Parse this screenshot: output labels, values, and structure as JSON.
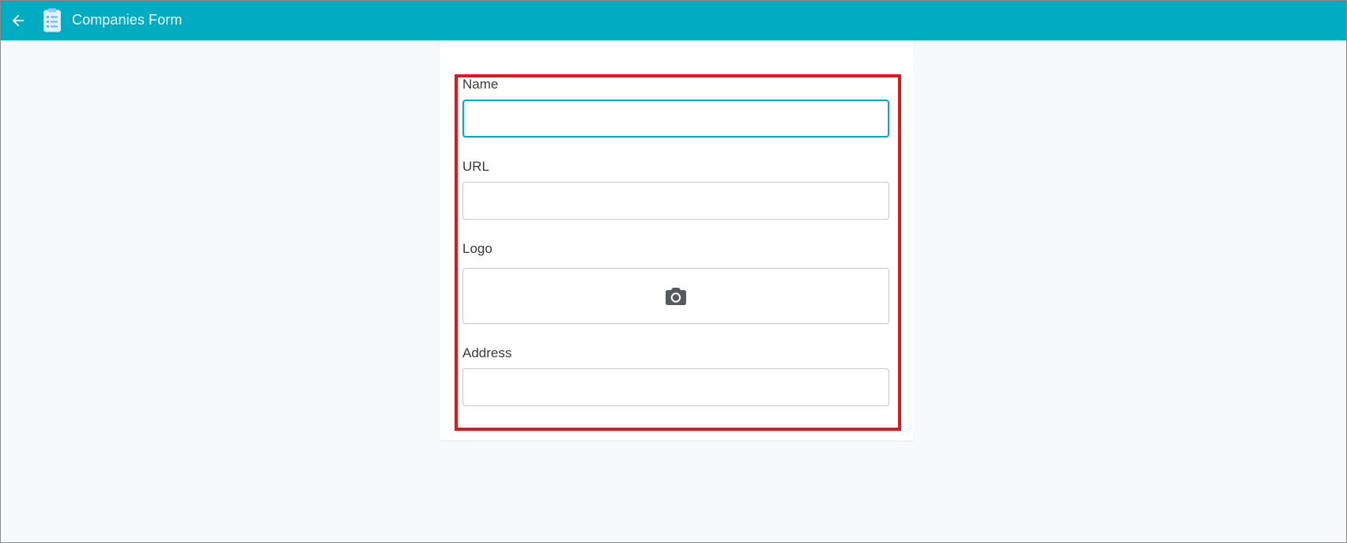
{
  "app_bar": {
    "title": "Companies Form",
    "back_icon": "arrow-left-icon",
    "app_icon": "clipboard-icon",
    "color": "#00acc1"
  },
  "form": {
    "fields": [
      {
        "label": "Name",
        "value": "",
        "placeholder": "",
        "focused": true
      },
      {
        "label": "URL",
        "value": "",
        "placeholder": ""
      },
      {
        "label": "Logo",
        "icon": "camera-icon"
      },
      {
        "label": "Address",
        "value": "",
        "placeholder": ""
      }
    ],
    "focus_color": "#00acc1",
    "highlight_color": "#e0171f"
  }
}
